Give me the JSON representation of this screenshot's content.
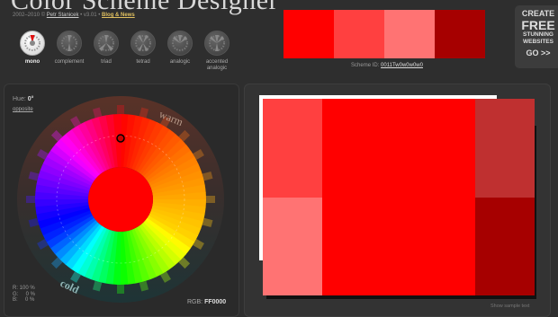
{
  "header": {
    "title": "Color Scheme Designer",
    "subline_prefix": "2002–2010 ©",
    "author": "Petr Stanicek",
    "version": "• v3.01 •",
    "news": "Blog & News"
  },
  "modes": [
    {
      "label": "mono",
      "active": true
    },
    {
      "label": "complement",
      "active": false
    },
    {
      "label": "triad",
      "active": false
    },
    {
      "label": "tetrad",
      "active": false
    },
    {
      "label": "analogic",
      "active": false
    },
    {
      "label": "accented\nanalogic",
      "active": false
    }
  ],
  "swatches": [
    "#ff0000",
    "#ff4040",
    "#ff7373",
    "#a60000"
  ],
  "scheme": {
    "label": "Scheme ID:",
    "id": "0011Tw0w0w0w0"
  },
  "promo": {
    "line1": "CREATE",
    "line2": "FREE",
    "line3": "STUNNING",
    "line4": "WEBSITES",
    "line5": "GO >>"
  },
  "hue": {
    "label": "Hue:",
    "value": "0°",
    "opposite": "opposite"
  },
  "wheel": {
    "warm": "warm",
    "cold": "cold",
    "center_color": "#ff0000"
  },
  "rgb": {
    "r": "R: 100 %",
    "g": "G:     0 %",
    "b": "B:     0 %",
    "hex_label": "RGB:",
    "hex": "FF0000"
  },
  "preview": {
    "main": "#ff0000",
    "light1": "#ff4040",
    "light2": "#ff7373",
    "dark1": "#bf3030",
    "dark2": "#a60000"
  },
  "footer": {
    "show_sample": "Show sample text"
  }
}
